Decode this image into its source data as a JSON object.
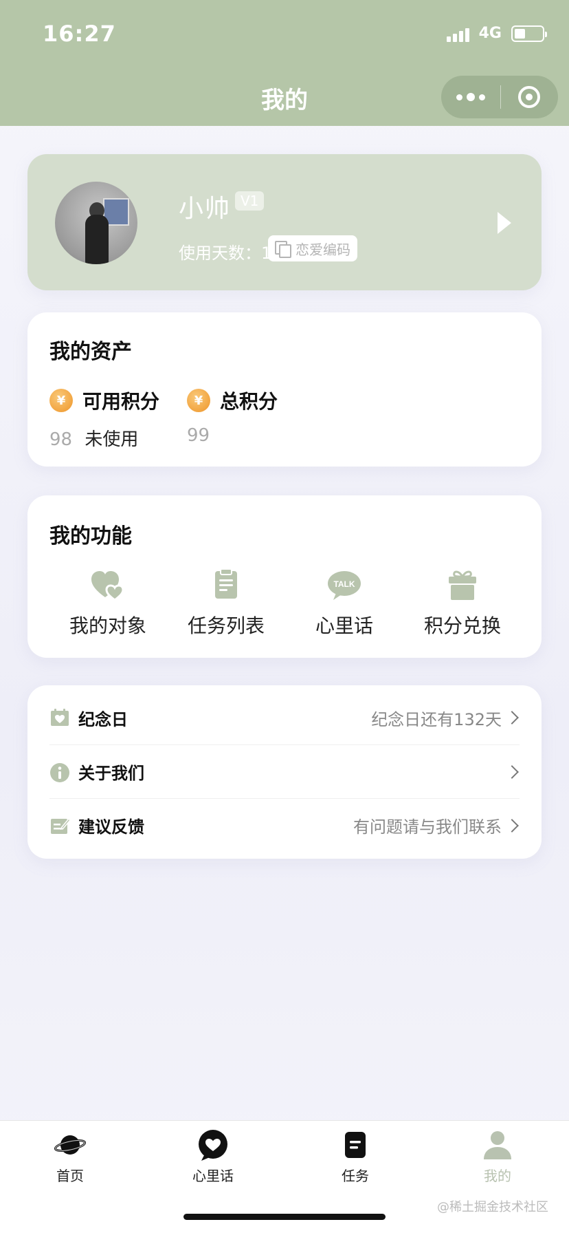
{
  "status_bar": {
    "time": "16:27",
    "network": "4G",
    "battery_level": 0.4
  },
  "nav": {
    "title": "我的"
  },
  "profile": {
    "nickname": "小帅",
    "level": "V1",
    "days": "使用天数：1天",
    "love_code_label": "恋爱编码"
  },
  "assets": {
    "title": "我的资产",
    "coin_glyph": "¥",
    "items": [
      {
        "label": "可用积分",
        "value": "98",
        "unit": "未使用"
      },
      {
        "label": "总积分",
        "value": "99",
        "unit": ""
      }
    ]
  },
  "functions": {
    "title": "我的功能",
    "items": [
      {
        "label": "我的对象",
        "icon": "hearts-icon"
      },
      {
        "label": "任务列表",
        "icon": "clipboard-icon"
      },
      {
        "label": "心里话",
        "icon": "talk-bubble-icon",
        "icon_text": "TALK"
      },
      {
        "label": "积分兑换",
        "icon": "gift-icon"
      }
    ]
  },
  "menu": [
    {
      "label": "纪念日",
      "detail": "纪念日还有132天",
      "icon": "calendar-heart-icon"
    },
    {
      "label": "关于我们",
      "detail": "",
      "icon": "info-icon"
    },
    {
      "label": "建议反馈",
      "detail": "有问题请与我们联系",
      "icon": "feedback-icon"
    }
  ],
  "tabbar": [
    {
      "label": "首页",
      "icon": "planet-icon"
    },
    {
      "label": "心里话",
      "icon": "heart-bubble-icon"
    },
    {
      "label": "任务",
      "icon": "task-icon"
    },
    {
      "label": "我的",
      "icon": "user-icon",
      "active": true
    }
  ],
  "watermark": "@稀土掘金技术社区",
  "colors": {
    "theme": "#b5c6a8",
    "icon": "#b8c4ad",
    "coin": "#f2a541",
    "active_tab": "#b8c2b0"
  }
}
